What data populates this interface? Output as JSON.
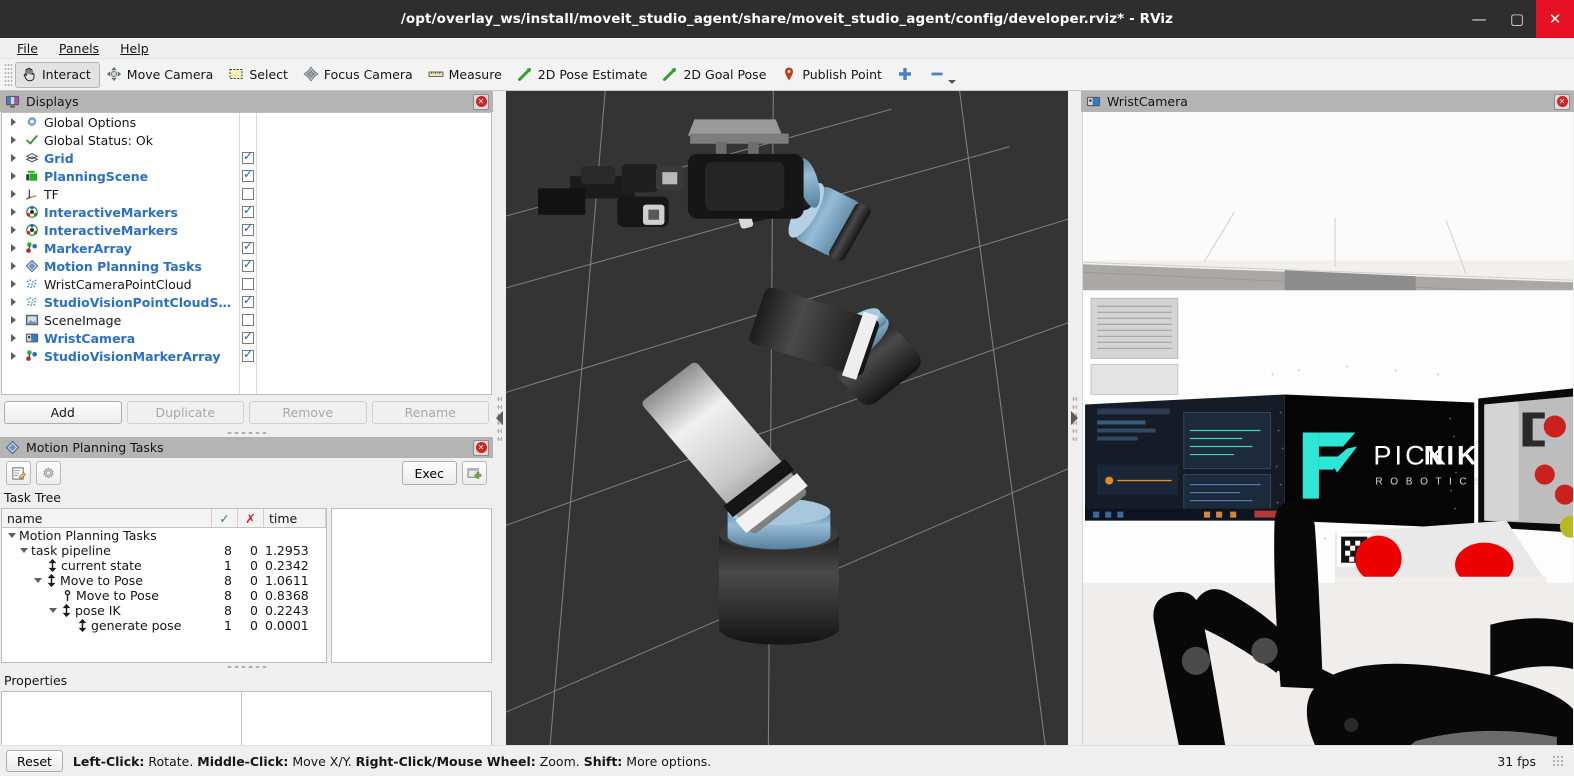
{
  "window": {
    "title": "/opt/overlay_ws/install/moveit_studio_agent/share/moveit_studio_agent/config/developer.rviz* - RViz",
    "minimize": "—",
    "maximize": "▢",
    "close": "✕"
  },
  "menubar": [
    {
      "label": "File"
    },
    {
      "label": "Panels"
    },
    {
      "label": "Help"
    }
  ],
  "toolbar": [
    {
      "label": "Interact",
      "icon": "hand-cursor-icon",
      "checked": true
    },
    {
      "label": "Move Camera",
      "icon": "move-camera-icon",
      "checked": false
    },
    {
      "label": "Select",
      "icon": "select-rect-icon",
      "checked": false
    },
    {
      "label": "Focus Camera",
      "icon": "focus-camera-icon",
      "checked": false
    },
    {
      "label": "Measure",
      "icon": "ruler-icon",
      "checked": false
    },
    {
      "label": "2D Pose Estimate",
      "icon": "pose-arrow-icon",
      "checked": false
    },
    {
      "label": "2D Goal Pose",
      "icon": "goal-arrow-icon",
      "checked": false
    },
    {
      "label": "Publish Point",
      "icon": "map-pin-icon",
      "checked": false
    },
    {
      "label": "",
      "icon": "plus-icon",
      "checked": false
    },
    {
      "label": "",
      "icon": "minus-icon",
      "checked": false
    }
  ],
  "displays": {
    "title": "Displays",
    "icon": "displays-panel-icon",
    "items": [
      {
        "label": "Global Options",
        "icon": "gear-icon",
        "enabled": false,
        "checkbox": null
      },
      {
        "label": "Global Status: Ok",
        "icon": "check-icon",
        "enabled": false,
        "checkbox": null
      },
      {
        "label": "Grid",
        "icon": "grid-icon",
        "enabled": true,
        "checkbox": true
      },
      {
        "label": "PlanningScene",
        "icon": "planningscene-icon",
        "enabled": true,
        "checkbox": true
      },
      {
        "label": "TF",
        "icon": "tf-axes-icon",
        "enabled": false,
        "checkbox": false
      },
      {
        "label": "InteractiveMarkers",
        "icon": "interactive-marker-icon",
        "enabled": true,
        "checkbox": true
      },
      {
        "label": "InteractiveMarkers",
        "icon": "interactive-marker-icon",
        "enabled": true,
        "checkbox": true
      },
      {
        "label": "MarkerArray",
        "icon": "marker-array-icon",
        "enabled": true,
        "checkbox": true
      },
      {
        "label": "Motion Planning Tasks",
        "icon": "diamond-icon",
        "enabled": true,
        "checkbox": true
      },
      {
        "label": "WristCameraPointCloud",
        "icon": "pointcloud-icon",
        "enabled": false,
        "checkbox": false
      },
      {
        "label": "StudioVisionPointCloudSn…",
        "icon": "pointcloud-icon",
        "enabled": true,
        "checkbox": true
      },
      {
        "label": "SceneImage",
        "icon": "image-icon",
        "enabled": false,
        "checkbox": false
      },
      {
        "label": "WristCamera",
        "icon": "camera-icon",
        "enabled": true,
        "checkbox": true
      },
      {
        "label": "StudioVisionMarkerArray",
        "icon": "marker-array-icon",
        "enabled": true,
        "checkbox": true
      }
    ],
    "buttons": [
      {
        "label": "Add",
        "enabled": true
      },
      {
        "label": "Duplicate",
        "enabled": false
      },
      {
        "label": "Remove",
        "enabled": false
      },
      {
        "label": "Rename",
        "enabled": false
      }
    ]
  },
  "motion_planning_tasks": {
    "title": "Motion Planning Tasks",
    "icon": "diamond-icon",
    "tools": [
      {
        "icon": "edit-note-icon",
        "name": "edit-tool"
      },
      {
        "icon": "gear-icon",
        "name": "settings-tool"
      }
    ],
    "exec_label": "Exec",
    "add_icon": "add-window-icon",
    "task_tree_label": "Task Tree",
    "columns": [
      "name",
      "✓",
      "✗",
      "time"
    ],
    "rows": [
      {
        "indent": 0,
        "name": "Motion Planning Tasks",
        "expander": "down",
        "stage_icon": null,
        "success": "",
        "failure": "",
        "time": ""
      },
      {
        "indent": 1,
        "name": "task pipeline",
        "expander": "down",
        "stage_icon": null,
        "success": "8",
        "failure": "0",
        "time": "1.2953"
      },
      {
        "indent": 2,
        "name": "current state",
        "expander": null,
        "stage_icon": "generator",
        "success": "1",
        "failure": "0",
        "time": "0.2342"
      },
      {
        "indent": 2,
        "name": "Move to Pose",
        "expander": "down",
        "stage_icon": "generator",
        "success": "8",
        "failure": "0",
        "time": "1.0611"
      },
      {
        "indent": 3,
        "name": "Move to Pose",
        "expander": null,
        "stage_icon": "connector",
        "success": "8",
        "failure": "0",
        "time": "0.8368"
      },
      {
        "indent": 3,
        "name": "pose IK",
        "expander": "down",
        "stage_icon": "generator",
        "success": "8",
        "failure": "0",
        "time": "0.2243"
      },
      {
        "indent": 4,
        "name": "generate pose",
        "expander": null,
        "stage_icon": "generator",
        "success": "1",
        "failure": "0",
        "time": "0.0001"
      }
    ],
    "properties_label": "Properties"
  },
  "wrist_camera": {
    "title": "WristCamera",
    "icon": "camera-icon",
    "logo_primary": "PICK",
    "logo_accent": "NIK",
    "logo_sub": "R O B O T I C S"
  },
  "statusbar": {
    "reset_label": "Reset",
    "hints": [
      {
        "bold": "Left-Click:",
        "text": " Rotate."
      },
      {
        "bold": "Middle-Click:",
        "text": " Move X/Y."
      },
      {
        "bold": "Right-Click/Mouse Wheel:",
        "text": " Zoom."
      },
      {
        "bold": "Shift:",
        "text": " More options."
      }
    ],
    "fps": "31 fps"
  },
  "colors": {
    "titlebar_bg": "#2e2e2e",
    "close_red": "#e81123",
    "enabled_blue": "#2a6fc9",
    "dock_header": "#b4b4b4",
    "viewport_bg": "#343434",
    "grid_line": "#8a8a8a",
    "robot_blue": "#7aa7c7",
    "accent_cyan": "#2ee6d6",
    "marker_red": "#ee0000"
  }
}
